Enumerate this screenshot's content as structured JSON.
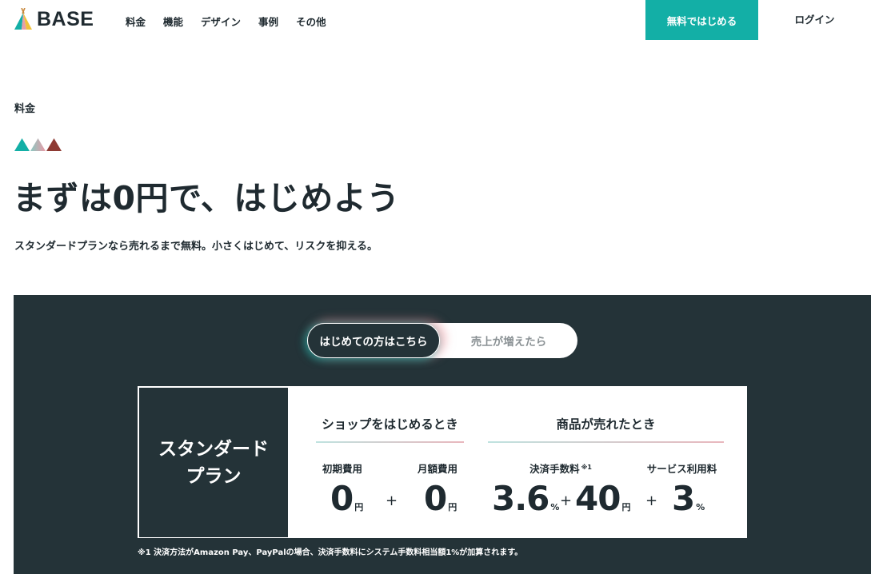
{
  "header": {
    "logo_text": "BASE",
    "nav": [
      "料金",
      "機能",
      "デザイン",
      "事例",
      "その他"
    ],
    "cta_label": "無料ではじめる",
    "login_label": "ログイン"
  },
  "hero": {
    "breadcrumb": "料金",
    "headline": "まずは0円で、はじめよう",
    "subline": "スタンダードプランなら売れるまで無料。小さくはじめて、リスクを抑える。"
  },
  "pricing": {
    "toggle_active": "はじめての方はこちら",
    "toggle_inactive": "売上が増えたら",
    "plan_line1": "スタンダード",
    "plan_line2": "プラン",
    "start_title": "ショップをはじめるとき",
    "sold_title": "商品が売れたとき",
    "fees": [
      {
        "label": "初期費用",
        "value": "0",
        "unit": "円"
      },
      {
        "label": "月額費用",
        "value": "0",
        "unit": "円"
      },
      {
        "label": "決済手数料",
        "note": "※1",
        "value": "3.6",
        "unit": "%"
      },
      {
        "label": "",
        "value": "40",
        "unit": "円"
      },
      {
        "label": "サービス利用料",
        "value": "3",
        "unit": "%"
      }
    ],
    "plus_sign": "+",
    "footnote": "※1 決済方法がAmazon Pay、PayPalの場合、決済手数料にシステム手数料相当額1%が加算されます。"
  },
  "colors": {
    "accent": "#13afa6",
    "dark_panel": "#243338",
    "triangle_teal": "#13afa6",
    "triangle_pink": "#e4a0ab",
    "triangle_brown": "#8e3a33"
  }
}
